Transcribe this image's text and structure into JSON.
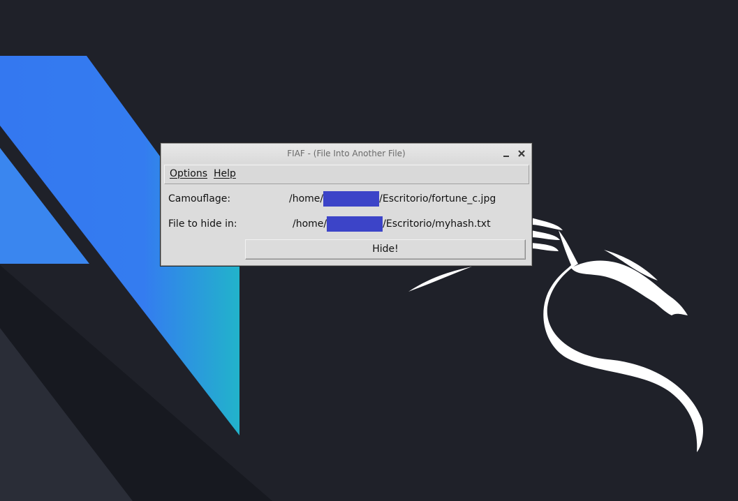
{
  "window": {
    "title": "FIAF - (File Into Another File)"
  },
  "menu": {
    "options": "Options",
    "help": "Help"
  },
  "form": {
    "camouflage_label": "Camouflage:",
    "camouflage_path_start": "/home/",
    "camouflage_path_end": "/Escritorio/fortune_c.jpg",
    "file_label": "File to hide in:",
    "file_path_start": "/home/",
    "file_path_end": "/Escritorio/myhash.txt",
    "hide_button": "Hide!"
  },
  "colors": {
    "redaction": "#3c44c8",
    "desktop_bg": "#1f2129",
    "accent_blue": "#367bf0",
    "accent_teal": "#23b2cb"
  },
  "icons": {
    "minimize": "minimize-icon",
    "close": "close-icon",
    "wallpaper_logo": "kali-dragon-logo"
  }
}
